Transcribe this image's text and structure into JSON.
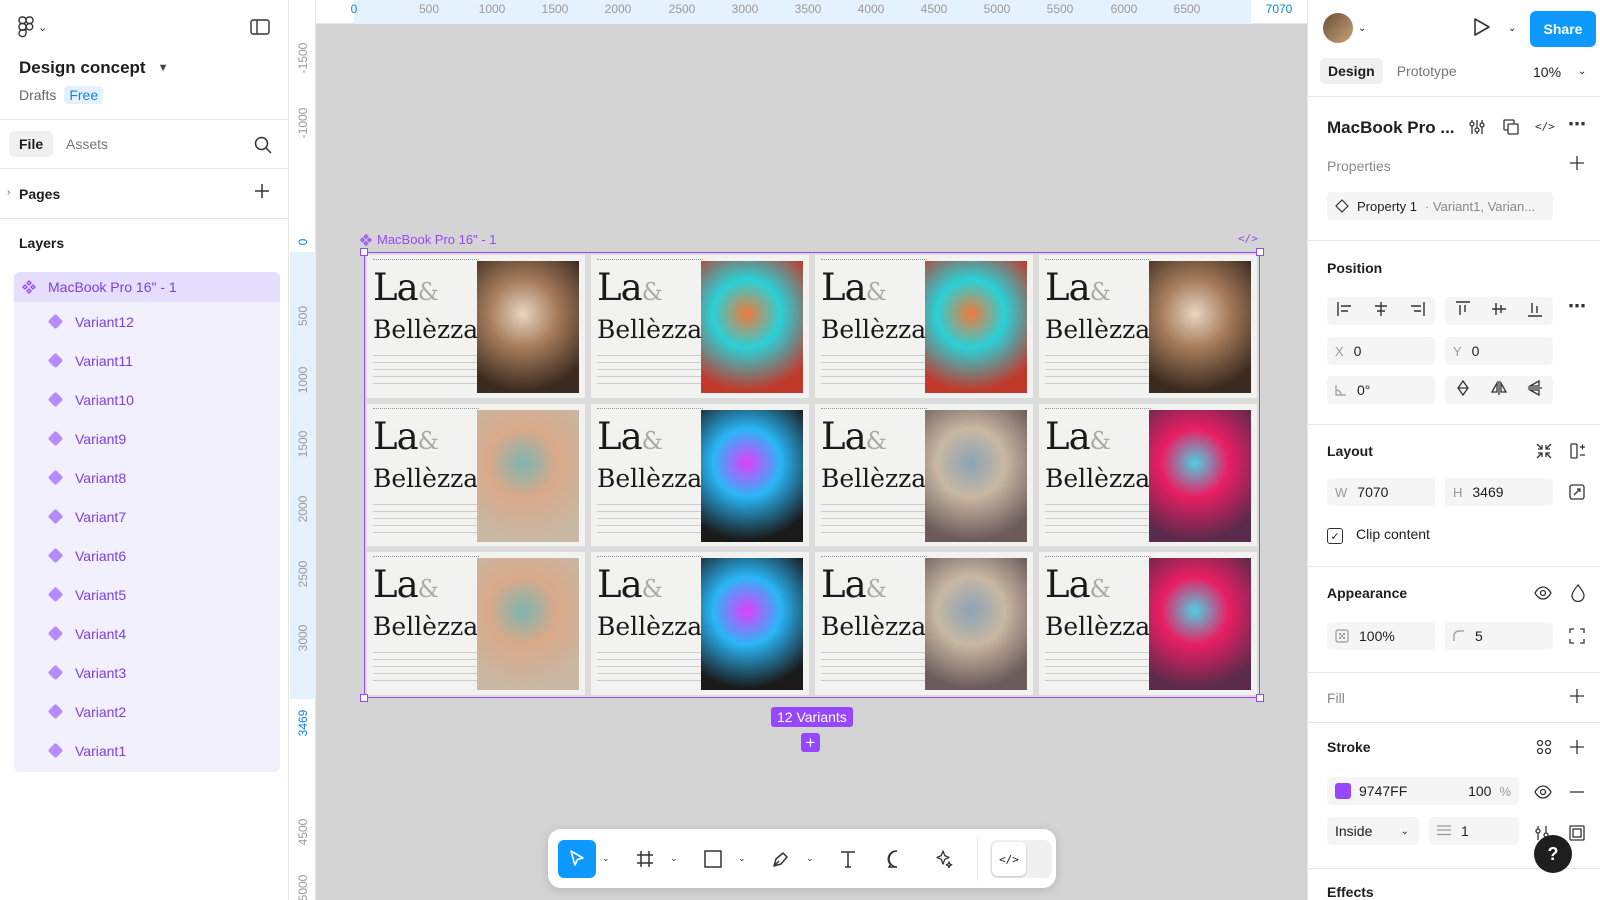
{
  "file": {
    "title": "Design concept",
    "location": "Drafts",
    "plan_badge": "Free"
  },
  "left_panel": {
    "tabs": [
      "File",
      "Assets"
    ],
    "pages_label": "Pages",
    "layers_label": "Layers",
    "layer_root": "MacBook Pro 16\" - 1",
    "layers": [
      "Variant12",
      "Variant11",
      "Variant10",
      "Variant9",
      "Variant8",
      "Variant7",
      "Variant6",
      "Variant5",
      "Variant4",
      "Variant3",
      "Variant2",
      "Variant1"
    ]
  },
  "rulers": {
    "top": [
      "0",
      "500",
      "1000",
      "1500",
      "2000",
      "2500",
      "3000",
      "3500",
      "4000",
      "4500",
      "5000",
      "5500",
      "6000",
      "6500",
      "7070"
    ],
    "left": [
      "-1500",
      "-1000",
      "0",
      "500",
      "1000",
      "1500",
      "2000",
      "2500",
      "3000",
      "3469",
      "4500",
      "5000"
    ]
  },
  "canvas": {
    "frame_label": "MacBook Pro 16\" - 1",
    "code_tag": "</>",
    "variant_title_line1": "La",
    "variant_title_amp": "&",
    "variant_title_line2": "Bellèzza",
    "variants_badge": "12 Variants",
    "add_label": "+"
  },
  "toolbar": {
    "tools": [
      "move",
      "frame",
      "shape",
      "pen",
      "text",
      "comment",
      "actions"
    ],
    "dev_mode_label": "</>"
  },
  "right_panel": {
    "share_label": "Share",
    "tabs": [
      "Design",
      "Prototype"
    ],
    "zoom": "10%",
    "component_name": "MacBook Pro ...",
    "properties_label": "Properties",
    "property_name": "Property 1",
    "property_values": "· Variant1, Varian...",
    "position_label": "Position",
    "x_label": "X",
    "x_value": "0",
    "y_label": "Y",
    "y_value": "0",
    "rotation_value": "0°",
    "layout_label": "Layout",
    "w_label": "W",
    "w_value": "7070",
    "h_label": "H",
    "h_value": "3469",
    "clip_content_label": "Clip content",
    "clip_content_checked": true,
    "appearance_label": "Appearance",
    "opacity_value": "100%",
    "radius_value": "5",
    "fill_label": "Fill",
    "stroke_label": "Stroke",
    "stroke_color_hex": "9747FF",
    "stroke_opacity": "100",
    "stroke_opacity_unit": "%",
    "stroke_position": "Inside",
    "stroke_weight": "1",
    "effects_label": "Effects",
    "help_label": "?"
  },
  "colors": {
    "accent": "#0d99ff",
    "component_purple": "#9747ff"
  }
}
